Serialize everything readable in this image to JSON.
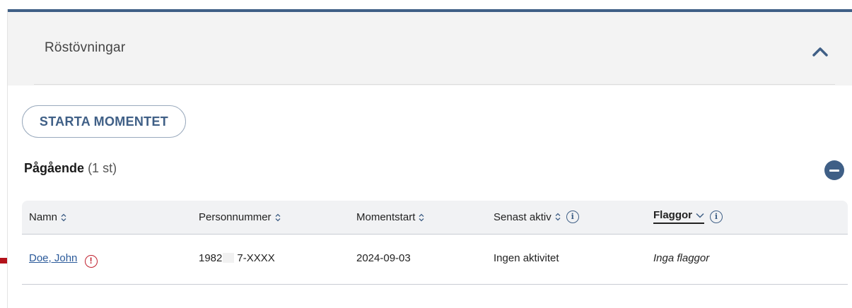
{
  "card": {
    "title": "Röstövningar"
  },
  "actions": {
    "start_label": "STARTA MOMENTET"
  },
  "section": {
    "title": "Pågående",
    "count": "(1 st)"
  },
  "table": {
    "columns": {
      "name": "Namn",
      "personnummer": "Personnummer",
      "momentstart": "Momentstart",
      "senast_aktiv": "Senast aktiv",
      "flaggor": "Flaggor"
    },
    "rows": [
      {
        "name": "Doe, John",
        "warning_glyph": "!",
        "personnummer_prefix": "1982",
        "personnummer_suffix": "7-XXXX",
        "momentstart": "2024-09-03",
        "senast_aktiv": "Ingen aktivitet",
        "flaggor": "Inga flaggor"
      }
    ]
  },
  "icons": {
    "info_glyph": "i"
  },
  "colors": {
    "primary": "#3f5f86",
    "link": "#2b5a9a",
    "warning": "#c0202e",
    "pointer_arrow": "#b3121a"
  }
}
